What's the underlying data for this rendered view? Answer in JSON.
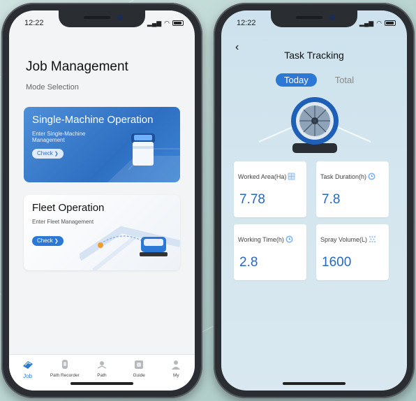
{
  "left_phone": {
    "status_time": "12:22",
    "title": "Job Management",
    "subtitle": "Mode Selection",
    "single_card": {
      "title": "Single-Machine Operation",
      "description": "Enter Single-Machine Management",
      "button": "Check"
    },
    "fleet_card": {
      "title": "Fleet Operation",
      "description": "Enter Fleet Management",
      "button": "Check"
    },
    "tabs": [
      {
        "label": "Job",
        "icon": "job-icon",
        "active": true
      },
      {
        "label": "Path Recorder",
        "icon": "path-recorder-icon",
        "active": false
      },
      {
        "label": "Path",
        "icon": "path-icon",
        "active": false
      },
      {
        "label": "Guide",
        "icon": "guide-icon",
        "active": false
      },
      {
        "label": "My",
        "icon": "user-icon",
        "active": false
      }
    ]
  },
  "right_phone": {
    "status_time": "12:22",
    "back_icon": "chevron-left-icon",
    "title": "Task Tracking",
    "toggle": {
      "today": "Today",
      "total": "Total",
      "selected": "Today"
    },
    "stats": [
      {
        "label": "Worked Area(Ha)",
        "value": "7.78",
        "icon": "area-grid-icon"
      },
      {
        "label": "Task Duration(h)",
        "value": "7.8",
        "icon": "clock-icon"
      },
      {
        "label": "Working Time(h)",
        "value": "2.8",
        "icon": "clock-icon"
      },
      {
        "label": "Spray Volume(L)",
        "value": "1600",
        "icon": "spray-icon"
      }
    ]
  },
  "colors": {
    "accent": "#2b78d6",
    "value_text": "#2468c4",
    "card_blue": "#3a7fd0",
    "background": "#b9d4d1"
  }
}
